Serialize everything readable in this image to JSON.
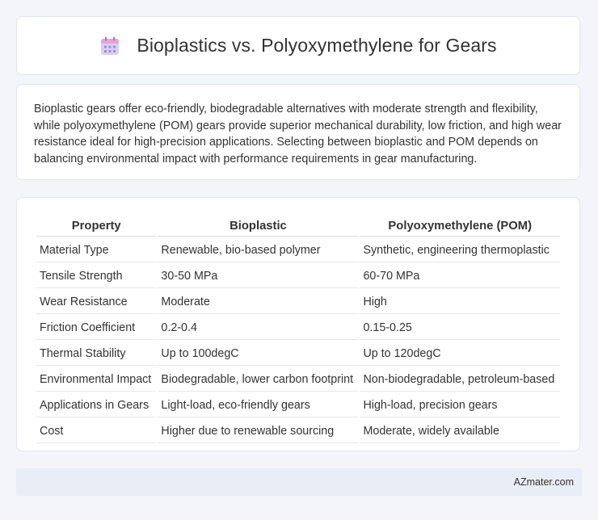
{
  "header": {
    "icon": "calendar-icon",
    "title": "Bioplastics vs. Polyoxymethylene for Gears"
  },
  "summary": {
    "text": "Bioplastic gears offer eco-friendly, biodegradable alternatives with moderate strength and flexibility, while polyoxymethylene (POM) gears provide superior mechanical durability, low friction, and high wear resistance ideal for high-precision applications. Selecting between bioplastic and POM depends on balancing environmental impact with performance requirements in gear manufacturing."
  },
  "table": {
    "headers": [
      "Property",
      "Bioplastic",
      "Polyoxymethylene (POM)"
    ],
    "rows": [
      [
        "Material Type",
        "Renewable, bio-based polymer",
        "Synthetic, engineering thermoplastic"
      ],
      [
        "Tensile Strength",
        "30-50 MPa",
        "60-70 MPa"
      ],
      [
        "Wear Resistance",
        "Moderate",
        "High"
      ],
      [
        "Friction Coefficient",
        "0.2-0.4",
        "0.15-0.25"
      ],
      [
        "Thermal Stability",
        "Up to 100degC",
        "Up to 120degC"
      ],
      [
        "Environmental Impact",
        "Biodegradable, lower carbon footprint",
        "Non-biodegradable, petroleum-based"
      ],
      [
        "Applications in Gears",
        "Light-load, eco-friendly gears",
        "High-load, precision gears"
      ],
      [
        "Cost",
        "Higher due to renewable sourcing",
        "Moderate, widely available"
      ]
    ]
  },
  "footer": {
    "brand": "AZmater.com"
  },
  "colors": {
    "background": "#f3f5f8",
    "card": "#ffffff",
    "footer": "#e8edf6",
    "icon_body": "#cfc3f2",
    "icon_top": "#e8a6cf"
  }
}
